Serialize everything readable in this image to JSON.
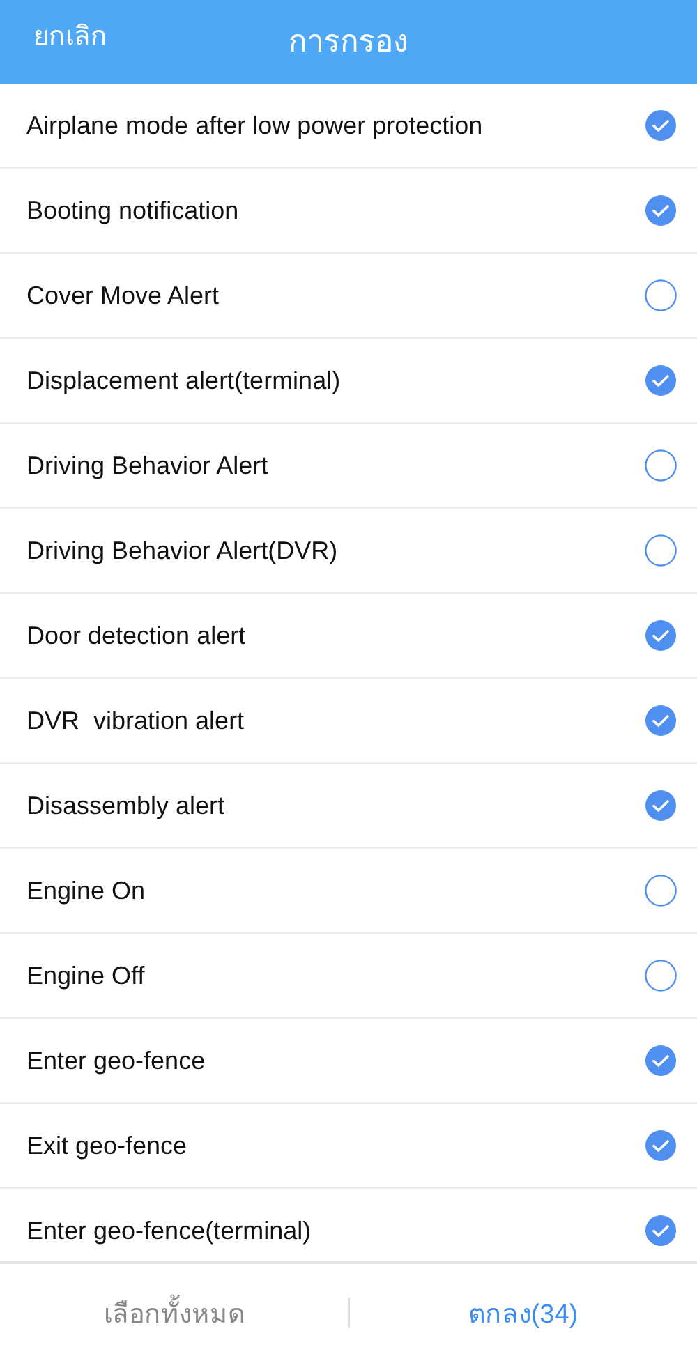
{
  "header": {
    "cancel": "ยกเลิก",
    "title": "การกรอง"
  },
  "items": [
    {
      "label": "Airplane mode after low power protection",
      "checked": true
    },
    {
      "label": "Booting notification",
      "checked": true
    },
    {
      "label": "Cover Move Alert",
      "checked": false
    },
    {
      "label": "Displacement alert(terminal)",
      "checked": true
    },
    {
      "label": "Driving Behavior Alert",
      "checked": false
    },
    {
      "label": "Driving Behavior Alert(DVR)",
      "checked": false
    },
    {
      "label": "Door detection alert",
      "checked": true
    },
    {
      "label": "DVR  vibration alert",
      "checked": true
    },
    {
      "label": "Disassembly alert",
      "checked": true
    },
    {
      "label": "Engine On",
      "checked": false
    },
    {
      "label": "Engine Off",
      "checked": false
    },
    {
      "label": "Enter geo-fence",
      "checked": true
    },
    {
      "label": "Exit geo-fence",
      "checked": true
    },
    {
      "label": "Enter geo-fence(terminal)",
      "checked": true
    }
  ],
  "footer": {
    "select_all": "เลือกทั้งหมด",
    "confirm": "ตกลง(34)"
  }
}
